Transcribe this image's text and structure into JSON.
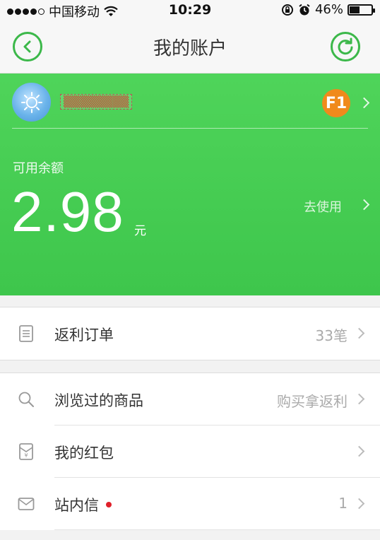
{
  "status_bar": {
    "carrier": "中国移动",
    "time": "10:29",
    "battery_percent": "46%",
    "battery_level": 0.46,
    "signal_bars_filled": 4,
    "signal_bars_total": 5
  },
  "nav": {
    "title": "我的账户",
    "back_icon": "back-arrow-icon",
    "refresh_icon": "refresh-icon"
  },
  "account": {
    "username": "▒▒▒▒▒▒▒▒",
    "level_badge": "F1",
    "balance_label": "可用余额",
    "balance_value": "2.98",
    "balance_unit": "元",
    "use_link": "去使用"
  },
  "menu_groups": [
    {
      "items": [
        {
          "label": "返利订单",
          "value": "33笔",
          "icon": "document-icon"
        }
      ]
    },
    {
      "items": [
        {
          "label": "浏览过的商品",
          "value": "购买拿返利",
          "icon": "search-icon"
        },
        {
          "label": "我的红包",
          "value": "",
          "icon": "red-envelope-icon"
        },
        {
          "label": "站内信",
          "value": "1",
          "icon": "mail-icon",
          "unread": true
        }
      ]
    }
  ],
  "colors": {
    "brand_green": "#3cb84a",
    "card_green": "#44c952",
    "badge_orange": "#f08a1c",
    "unread_red": "#e0202a"
  }
}
